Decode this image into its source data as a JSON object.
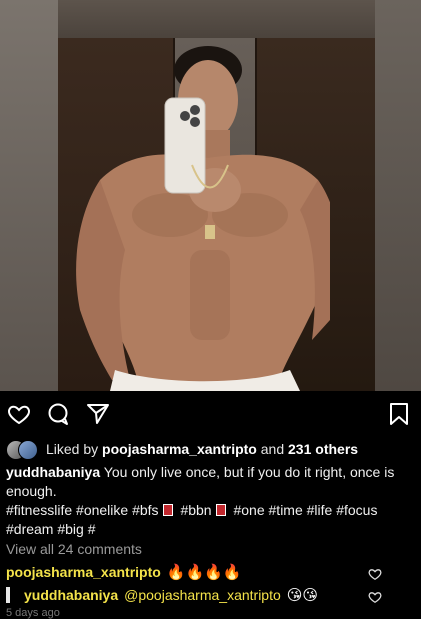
{
  "post": {
    "image_alt": "Mirror selfie of a shirtless man holding a phone",
    "liked_by_prefix": "Liked by",
    "liked_by_user": "poojasharma_xantripto",
    "liked_by_suffix": "and",
    "liked_by_others": "231 others",
    "caption_user": "yuddhabaniya",
    "caption_text": "You only live once, but if you do it right, once is enough.",
    "tags_part1": "#fitnesslife #onelike #bfs",
    "tags_part2": "#bbn",
    "tags_part3": "#one #time #life #focus #dream #big #",
    "view_all_comments": "View all 24 comments",
    "time_text": "5 days ago"
  },
  "comments": [
    {
      "user": "poojasharma_xantripto",
      "text": "🔥🔥🔥🔥"
    },
    {
      "user": "yuddhabaniya",
      "mention": "@poojasharma_xantripto",
      "text": "😘😘"
    }
  ],
  "icons": {
    "like": "heart-icon",
    "comment": "comment-icon",
    "share": "send-icon",
    "save": "bookmark-icon"
  },
  "colors": {
    "background": "#000000",
    "highlight_text": "#f4e34a",
    "muted_text": "#9a9a9a"
  }
}
